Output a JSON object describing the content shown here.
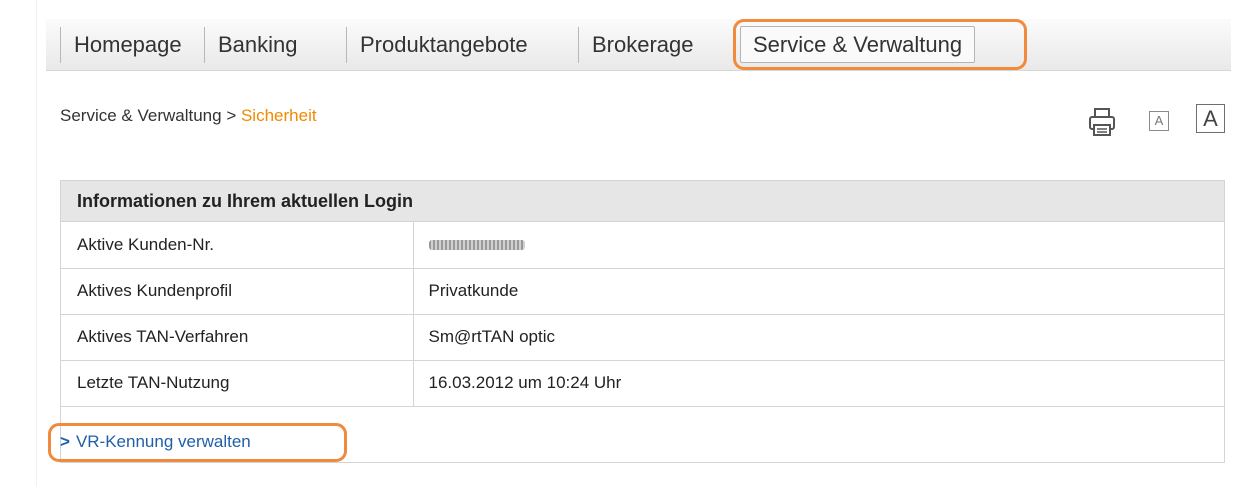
{
  "nav": {
    "items": [
      {
        "label": "Homepage"
      },
      {
        "label": "Banking"
      },
      {
        "label": "Produktangebote"
      },
      {
        "label": "Brokerage"
      },
      {
        "label": "Service & Verwaltung"
      }
    ],
    "active_index": 4
  },
  "breadcrumb": {
    "parent": "Service & Verwaltung",
    "separator": " > ",
    "current": "Sicherheit"
  },
  "tools": {
    "print_icon": "printer-icon",
    "small_font_label": "A",
    "large_font_label": "A"
  },
  "info": {
    "heading": "Informationen zu Ihrem aktuellen Login",
    "rows": [
      {
        "key": "Aktive Kunden-Nr.",
        "value": ""
      },
      {
        "key": "Aktives Kundenprofil",
        "value": "Privatkunde"
      },
      {
        "key": "Aktives TAN-Verfahren",
        "value": "Sm@rtTAN optic"
      },
      {
        "key": "Letzte TAN-Nutzung",
        "value": "16.03.2012 um 10:24 Uhr"
      }
    ]
  },
  "link": {
    "chevron": ">",
    "label": "VR-Kennung verwalten"
  },
  "colors": {
    "highlight": "#f08a3c",
    "accent": "#f08a00",
    "link": "#1f5fa8"
  }
}
